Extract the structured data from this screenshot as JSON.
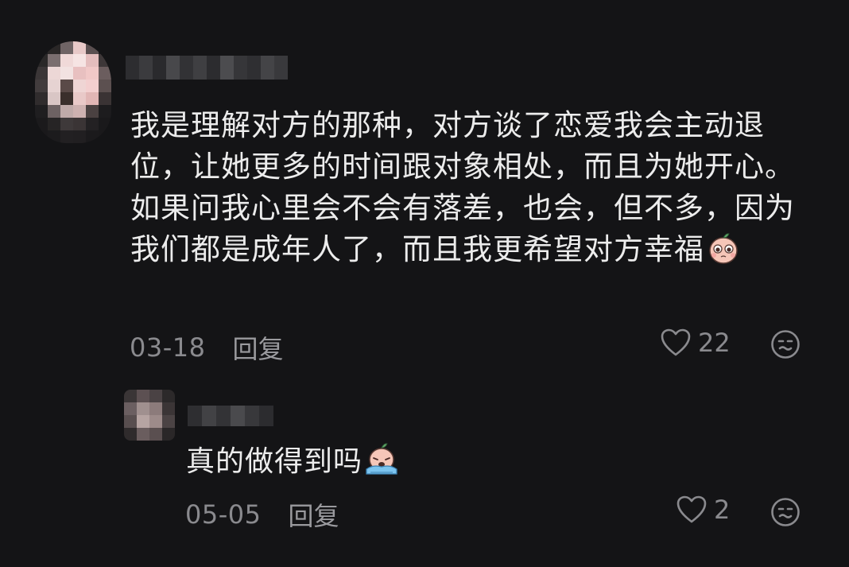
{
  "comment": {
    "text": "我是理解对方的那种，对方谈了恋爱我会主动退位，让她更多的时间跟对象相处，而且为她开心。如果问我心里会不会有落差，也会，但不多，因为我们都是成年人了，而且我更希望对方幸福",
    "emoji": "pleading-face-sticker",
    "date": "03-18",
    "reply_label": "回复",
    "like_count": "22",
    "avatar": {
      "pixels": [
        "#1c1c1e",
        "#2a2727",
        "#6f6465",
        "#e8c9c8",
        "#5a4f50",
        "#1e1d1f",
        "#2a2828",
        "#7a6e6f",
        "#f0d9d8",
        "#f6e4e3",
        "#e4bdbd",
        "#3d3738",
        "#3b3637",
        "#ecd7d6",
        "#f2e2e1",
        "#e8c0c0",
        "#f1c8c7",
        "#6b5d5e",
        "#423c3d",
        "#e6d3d2",
        "#5a4a48",
        "#efd5d4",
        "#f3cfcf",
        "#5c5050",
        "#302c2d",
        "#d9c6c5",
        "#3a2f2c",
        "#e9c9c8",
        "#e1b6b5",
        "#3a3334",
        "#1f1e20",
        "#6d6263",
        "#bfaaa9",
        "#cdb1b0",
        "#4a4141",
        "#1d1c1e",
        "#1b1a1c",
        "#262425",
        "#3e393a",
        "#3a3435",
        "#232123",
        "#1a191b",
        "#1a191b",
        "#1c1b1d",
        "#222022",
        "#211f21",
        "#1b1a1c",
        "#1a191b"
      ]
    },
    "username_blur": [
      "#2d2d30",
      "#3b3b3e",
      "#2a2a2d",
      "#48484b",
      "#323235",
      "#3f3f42",
      "#2c2c2f",
      "#4c4c4f",
      "#363639",
      "#2f2f32",
      "#444447",
      "#39393c"
    ]
  },
  "reply": {
    "text": "真的做得到吗",
    "emoji": "crying-face-sticker",
    "date": "05-05",
    "reply_label": "回复",
    "like_count": "2",
    "avatar": {
      "pixels": [
        "#3a3536",
        "#5c5052",
        "#4a4244",
        "#2c292a",
        "#6b5f61",
        "#a0908f",
        "#8c7b7b",
        "#3b3536",
        "#584e4f",
        "#b6a4a2",
        "#9d8b8a",
        "#4b4344",
        "#2f2b2c",
        "#6a5d5e",
        "#5a4f50",
        "#2a2728"
      ]
    },
    "username_blur": [
      "#2e2e31",
      "#424245",
      "#333336",
      "#4a4a4d",
      "#38383b",
      "#2c2c2f"
    ]
  },
  "colors": {
    "background": "#141416",
    "text": "#ececec",
    "meta": "#8a8a8e"
  }
}
